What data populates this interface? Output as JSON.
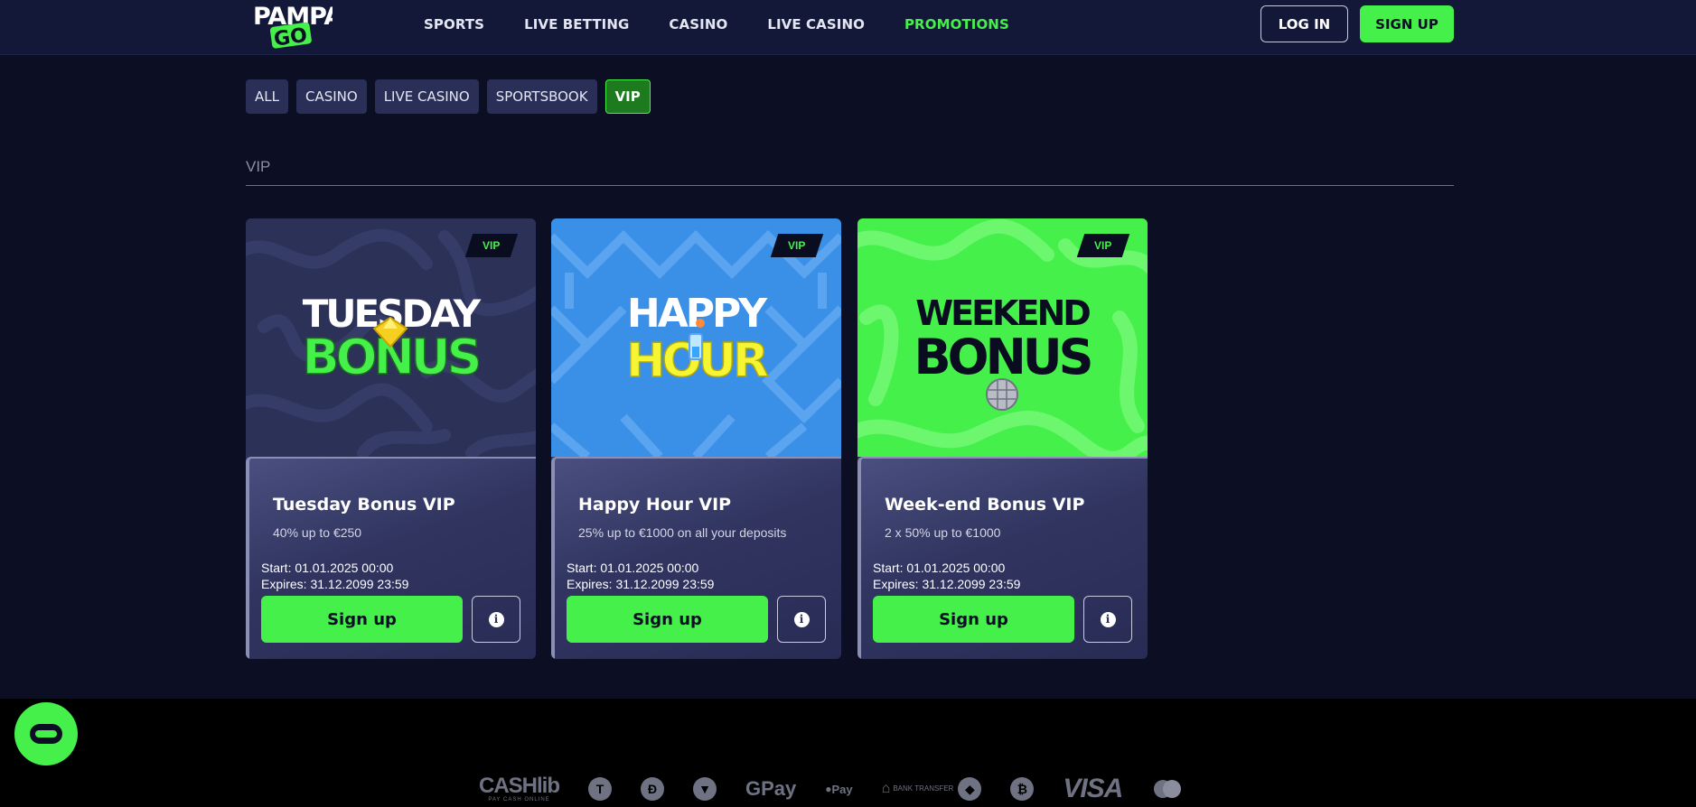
{
  "header": {
    "logo_alt": "PAMPA GO",
    "logo_top": "PAMPA",
    "logo_bottom": "GO",
    "nav": [
      {
        "label": "SPORTS",
        "active": false
      },
      {
        "label": "LIVE BETTING",
        "active": false
      },
      {
        "label": "CASINO",
        "active": false
      },
      {
        "label": "LIVE CASINO",
        "active": false
      },
      {
        "label": "PROMOTIONS",
        "active": true
      }
    ],
    "login_label": "LOG IN",
    "signup_label": "SIGN UP"
  },
  "filters": [
    {
      "label": "ALL",
      "active": false
    },
    {
      "label": "CASINO",
      "active": false
    },
    {
      "label": "LIVE CASINO",
      "active": false
    },
    {
      "label": "SPORTSBOOK",
      "active": false
    },
    {
      "label": "VIP",
      "active": true
    }
  ],
  "section": {
    "title": "VIP"
  },
  "cards": [
    {
      "tag": "VIP",
      "banner_line1": "TUESDAY",
      "banner_line2": "BONUS",
      "title": "Tuesday Bonus VIP",
      "subtitle": "40% up to €250",
      "start": "Start: 01.01.2025 00:00",
      "expires": "Expires: 31.12.2099 23:59",
      "button_label": "Sign up"
    },
    {
      "tag": "VIP",
      "banner_line1": "HAPPY",
      "banner_line2": "HOUR",
      "title": "Happy Hour VIP",
      "subtitle": "25% up to €1000 on all your deposits",
      "start": "Start: 01.01.2025 00:00",
      "expires": "Expires: 31.12.2099 23:59",
      "button_label": "Sign up"
    },
    {
      "tag": "VIP",
      "banner_line1": "WEEKEND",
      "banner_line2": "BONUS",
      "title": "Week-end Bonus VIP",
      "subtitle": "2 x 50% up to €1000",
      "start": "Start: 01.01.2025 00:00",
      "expires": "Expires: 31.12.2099 23:59",
      "button_label": "Sign up"
    }
  ],
  "footer": {
    "payments": [
      "CASHlib",
      "GPay",
      "Pay",
      "VISA"
    ],
    "cashlib_tagline": "PAY CASH ONLINE",
    "bank_transfer": "BANK TRANSFER"
  },
  "colors": {
    "background": "#0c0f24",
    "header": "#131838",
    "accent": "#45f04a",
    "card": "#2a2e57",
    "vip_filter_bg": "#1d7a1f",
    "happy_hour_blue": "#3a8fe6",
    "weekend_green": "#45f04a",
    "tuesday_navy": "#2c3158",
    "hour_yellow": "#f5f534"
  },
  "icons": {
    "info": "info-icon",
    "chat": "chat-icon",
    "diamond": "diamond-icon",
    "drink": "cocktail-icon",
    "disco_ball": "disco-ball-icon"
  }
}
